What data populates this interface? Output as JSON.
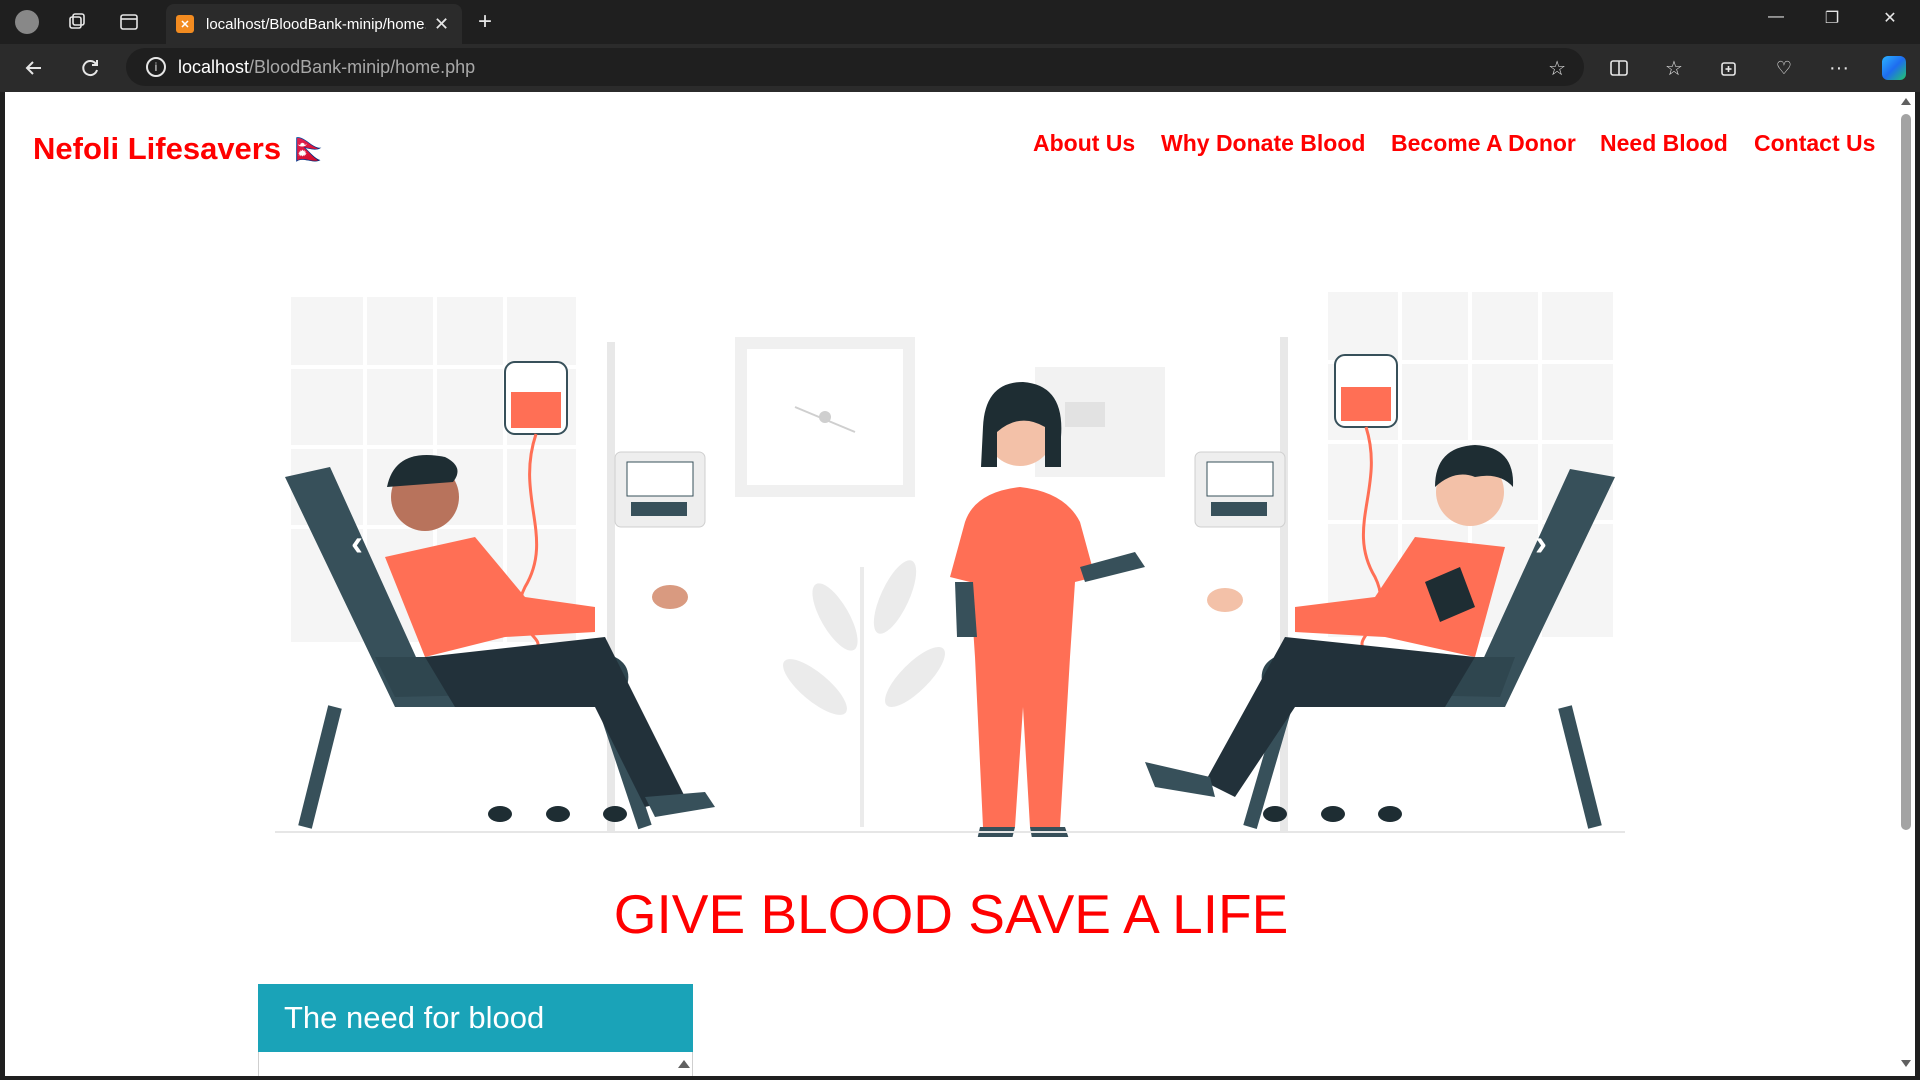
{
  "browser": {
    "tab_title": "localhost/BloodBank-minip/home.php",
    "url_host": "localhost",
    "url_path": "/BloodBank-minip/home.php"
  },
  "site": {
    "brand": "Nefoli Lifesavers 🇳🇵",
    "menu": [
      "About Us",
      "Why Donate Blood",
      "Become A Donor",
      "Need Blood",
      "Contact Us"
    ]
  },
  "hero": {
    "slogan": "GIVE BLOOD SAVE A LIFE",
    "carousel_prev": "‹",
    "carousel_next": "›"
  },
  "card": {
    "title": "The need for blood"
  },
  "colors": {
    "brand_red": "#ff0000",
    "card_teal": "#1aa3b8",
    "illustration_coral": "#ff6f55",
    "chair_slate": "#37505a"
  }
}
